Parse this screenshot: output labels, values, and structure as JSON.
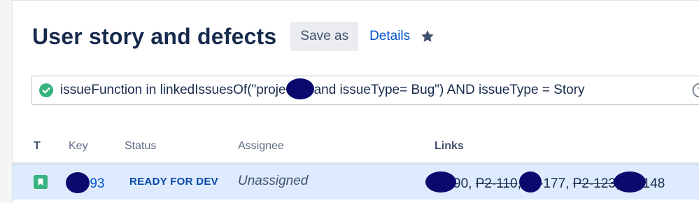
{
  "header": {
    "title": "User story and defects",
    "save_as_label": "Save as",
    "details_label": "Details",
    "star_icon": "star-icon"
  },
  "search": {
    "query_prefix": "issueFunction in linkedIssuesOf(\"project",
    "query_suffix": " and issueType= Bug\") AND issueType = Story",
    "status_icon": "check-circle-icon"
  },
  "table": {
    "columns": {
      "type": "T",
      "key": "Key",
      "status": "Status",
      "assignee": "Assignee",
      "links": "Links"
    },
    "rows": [
      {
        "type_icon": "story-icon",
        "key": "-93",
        "status": "READY FOR DEV",
        "assignee": "Unassigned",
        "links": {
          "l1": "90",
          "sep1": ", ",
          "l2": "P2-110",
          "sep2": ", ",
          "l3": "-177",
          "sep3": ", ",
          "l4": "P2-123",
          "sep4": ", ",
          "l5": "148"
        }
      }
    ]
  },
  "colors": {
    "accent": "#0052cc",
    "row_highlight": "#deebff",
    "success": "#36b37e"
  }
}
